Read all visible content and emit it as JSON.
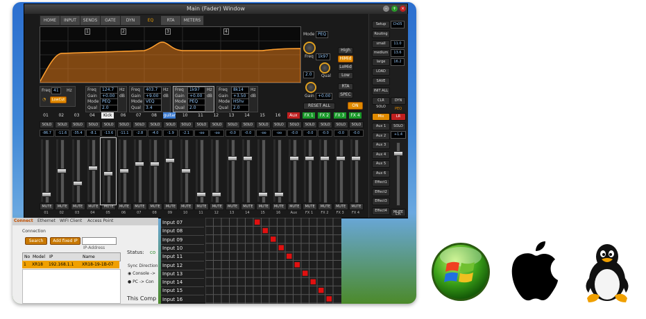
{
  "window": {
    "title": "Main (Fader) Window"
  },
  "tabs": [
    {
      "label": "HOME",
      "active": false
    },
    {
      "label": "INPUT",
      "active": false
    },
    {
      "label": "SENDS",
      "active": false
    },
    {
      "label": "GATE",
      "active": false
    },
    {
      "label": "DYN",
      "active": false
    },
    {
      "label": "EQ",
      "active": true
    },
    {
      "label": "RTA",
      "active": false
    },
    {
      "label": "METERS",
      "active": false
    }
  ],
  "eq": {
    "band_markers": [
      "1",
      "2",
      "3",
      "4"
    ],
    "mode_label": "Mode",
    "mode_value": "PEQ",
    "freq_label": "Freq",
    "freq_value": "1k97",
    "qual_label": "Qual",
    "qual_value": "2.0",
    "gain_label": "Gain",
    "gain_value": "+0.00",
    "band_buttons": [
      "High",
      "HiMid",
      "LoMid",
      "Low"
    ],
    "rta_label": "RTA",
    "spec_label": "SPEC",
    "reset_label": "RESET ALL",
    "on_label": "ON",
    "low_cut": {
      "freq_label": "Freq",
      "freq_value": "41",
      "unit": "Hz",
      "lowcut_label": "LowCut"
    },
    "bands": [
      {
        "freq": "124.7",
        "gain": "+0.00",
        "mode": "PEQ",
        "qual": "2.0"
      },
      {
        "freq": "403.7",
        "gain": "+9.00",
        "mode": "VEQ",
        "qual": "3.4"
      },
      {
        "freq": "1k97",
        "gain": "+0.00",
        "mode": "PEQ",
        "qual": "2.0"
      },
      {
        "freq": "8k14",
        "gain": "+3.50",
        "mode": "HShv",
        "qual": "2.0"
      }
    ],
    "row_labels": {
      "freq": "Freq",
      "gain": "Gain",
      "mode": "Mode",
      "qual": "Qual",
      "hz": "Hz",
      "db": "dB"
    }
  },
  "channels": {
    "numbers": [
      "01",
      "02",
      "03",
      "04",
      "Kick",
      "06",
      "07",
      "08",
      "guitar",
      "10",
      "11",
      "12",
      "13",
      "14",
      "15",
      "16",
      "Aux",
      "FX 1",
      "FX 2",
      "FX 3",
      "FX 4"
    ],
    "db": [
      "-86.7",
      "-11.6",
      "-35.4",
      "-8.1",
      "-13.6",
      "-11.1",
      "-2.8",
      "-4.0",
      "-1.9",
      "-2.1",
      "-oo",
      "-oo",
      "-0.0",
      "-0.0",
      "-oo",
      "-oo",
      "-0.0",
      "-0.0",
      "-0.0",
      "-0.0",
      "-0.0"
    ],
    "labels": [
      "01",
      "02",
      "03",
      "04",
      "05",
      "06",
      "07",
      "08",
      "09",
      "10",
      "11",
      "12",
      "13",
      "14",
      "15",
      "16",
      "Aux",
      "FX 1",
      "FX 2",
      "FX 3",
      "FX 4"
    ],
    "fader_levels": [
      0.1,
      0.5,
      0.28,
      0.55,
      0.45,
      0.5,
      0.62,
      0.62,
      0.68,
      0.5,
      0.1,
      0.1,
      0.72,
      0.72,
      0.1,
      0.1,
      0.72,
      0.72,
      0.72,
      0.72,
      0.72
    ],
    "solo_label": "SOLO",
    "mute_label": "MUTE"
  },
  "right_panel": {
    "setup": "Setup",
    "ch05": "Ch05",
    "routing": "Routing",
    "small": "small",
    "small_val": "11.0",
    "medium": "medium",
    "medium_val": "13.6",
    "large": "large",
    "large_val": "16.2",
    "load": "LOAD",
    "save": "SAVE",
    "init_all": "INIT ALL",
    "clr_solo": "CLR SOLO",
    "dyn": "DYN",
    "mix": "Mix",
    "lr": "LR",
    "peq": "PEQ",
    "solo": "SOLO",
    "lr_db": "+1.4",
    "sends": [
      "Aux 1",
      "Aux 2",
      "Aux 3",
      "Aux 4",
      "Aux 5",
      "Aux 6",
      "Effect1",
      "Effect2",
      "Effect3",
      "Effect4"
    ],
    "mute": "MUTE",
    "lr_label": "LR"
  },
  "connect": {
    "tabs": [
      "Connect",
      "Ethernet",
      "WIFI Client",
      "Access Point"
    ],
    "group_label": "Connection",
    "search": "Search",
    "add_fixed_ip": "Add fixed IP",
    "ip_address_label": "IP-Address",
    "headers": [
      "No",
      "Model",
      "IP",
      "Name"
    ],
    "rows": [
      [
        "1",
        "XR18",
        "192.168.1.1",
        "XR18-19-1B-07"
      ]
    ],
    "status_label": "Status:",
    "status_value": "co",
    "sync_label": "Sync Direction",
    "sync_opt1": "Console ->",
    "sync_opt2": "PC -> Con",
    "footer": "This Comp"
  },
  "routing": {
    "inputs": [
      "Input 07",
      "Input 08",
      "Input 09",
      "Input 10",
      "Input 11",
      "Input 12",
      "Input 13",
      "Input 14",
      "Input 15",
      "Input 16"
    ]
  },
  "os_icons": [
    "windows-logo",
    "apple-logo",
    "linux-tux"
  ],
  "colors": {
    "accent": "#e08a00",
    "eq_curve": "#e07a1a",
    "route_dot": "#e01010",
    "green_fx": "#1a9a2a",
    "red_lr": "#c02020"
  }
}
